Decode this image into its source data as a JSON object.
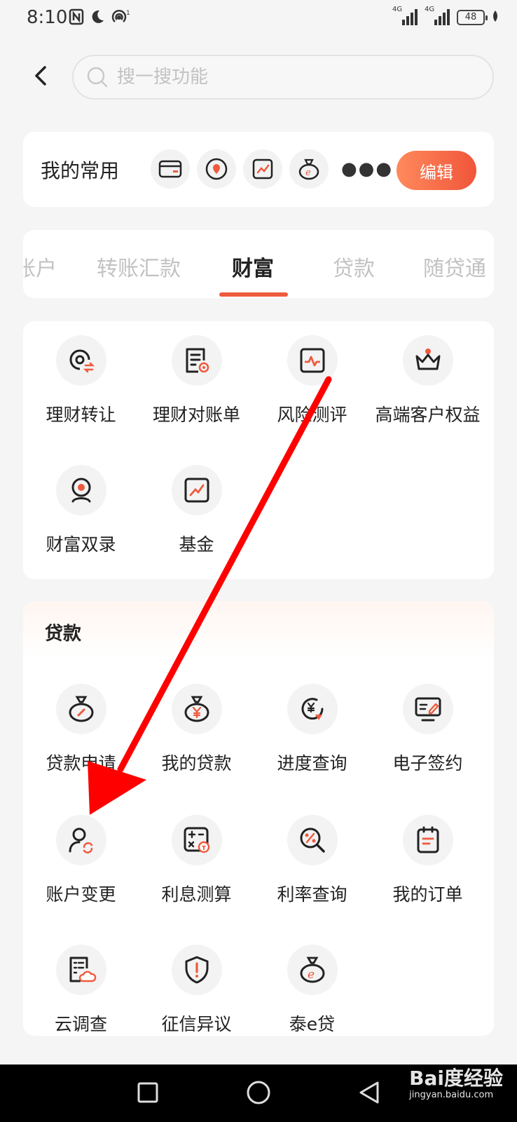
{
  "status_bar": {
    "time": "8:10",
    "signal_1_label": "4G",
    "signal_2_label": "4G",
    "battery": "48"
  },
  "search": {
    "placeholder": "搜一搜功能"
  },
  "favorites": {
    "title": "我的常用",
    "edit_label": "编辑",
    "icons": [
      "card-icon",
      "location-icon",
      "chart-icon",
      "money-bag-icon"
    ]
  },
  "tabs": [
    {
      "label": "账户",
      "active": false
    },
    {
      "label": "转账汇款",
      "active": false
    },
    {
      "label": "财富",
      "active": true
    },
    {
      "label": "贷款",
      "active": false
    },
    {
      "label": "随贷通",
      "active": false
    }
  ],
  "wealth_section": {
    "items": [
      {
        "label": "理财转让",
        "icon": "transfer-target-icon"
      },
      {
        "label": "理财对账单",
        "icon": "statement-icon"
      },
      {
        "label": "风险测评",
        "icon": "risk-assessment-icon"
      },
      {
        "label": "高端客户权益",
        "icon": "crown-icon"
      },
      {
        "label": "财富双录",
        "icon": "camera-record-icon"
      },
      {
        "label": "基金",
        "icon": "fund-chart-icon"
      }
    ]
  },
  "loan_section": {
    "title": "贷款",
    "items": [
      {
        "label": "贷款申请",
        "icon": "loan-apply-icon"
      },
      {
        "label": "我的贷款",
        "icon": "money-bag-yen-icon"
      },
      {
        "label": "进度查询",
        "icon": "progress-icon"
      },
      {
        "label": "电子签约",
        "icon": "e-sign-icon"
      },
      {
        "label": "账户变更",
        "icon": "account-change-icon"
      },
      {
        "label": "利息测算",
        "icon": "calculator-icon"
      },
      {
        "label": "利率查询",
        "icon": "rate-query-icon"
      },
      {
        "label": "我的订单",
        "icon": "order-icon"
      },
      {
        "label": "云调查",
        "icon": "cloud-survey-icon"
      },
      {
        "label": "征信异议",
        "icon": "shield-alert-icon"
      },
      {
        "label": "泰e贷",
        "icon": "money-bag-e-icon"
      }
    ]
  },
  "watermark": {
    "brand": "Bai度经验",
    "url": "jingyan.baidu.com"
  },
  "colors": {
    "accent": "#ee5a3d",
    "annotation_arrow": "#ff0000"
  }
}
